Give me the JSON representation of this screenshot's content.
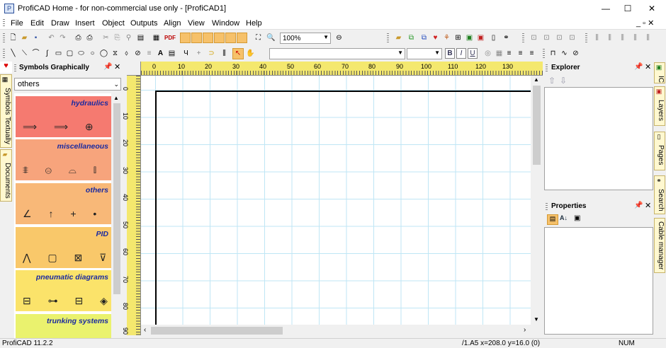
{
  "window": {
    "title": "ProfiCAD Home - for non-commercial use only - [ProfiCAD1]",
    "minimize": "—",
    "maximize": "☐",
    "close": "✕"
  },
  "menu": [
    "File",
    "Edit",
    "Draw",
    "Insert",
    "Object",
    "Outputs",
    "Align",
    "View",
    "Window",
    "Help"
  ],
  "mdi_controls": "_ ▫ ✕",
  "toolbar": {
    "zoom_value": "100%"
  },
  "left_tabs": [
    "Symbols Textually",
    "Documents"
  ],
  "symbols_panel": {
    "title": "Symbols Graphically",
    "category_select": "others",
    "categories": [
      {
        "label": "hydraulics",
        "color": "#f57a70",
        "symbols": "⟹ ⟹ ⊕"
      },
      {
        "label": "miscellaneous",
        "color": "#f7a47c",
        "symbols": "⩨ ⊜ ⌓ ⫾"
      },
      {
        "label": "others",
        "color": "#f8b878",
        "symbols": "∠ ↑ + •"
      },
      {
        "label": "PID",
        "color": "#f9c86a",
        "symbols": "⋀ ▢ ⊠ ⊽"
      },
      {
        "label": "pneumatic diagrams",
        "color": "#fbe36a",
        "symbols": "⊟ ⊶ ⊟ ◈"
      },
      {
        "label": "trunking systems",
        "color": "#eaf26e",
        "symbols": ""
      }
    ]
  },
  "ruler": {
    "h_ticks": [
      "0",
      "10",
      "20",
      "30",
      "40",
      "50",
      "60",
      "70",
      "80",
      "90",
      "100",
      "110",
      "120",
      "130"
    ],
    "v_ticks": [
      "0",
      "10",
      "20",
      "30",
      "40",
      "50",
      "60",
      "70",
      "80",
      "90"
    ]
  },
  "explorer": {
    "title": "Explorer"
  },
  "properties": {
    "title": "Properties"
  },
  "right_tabs": [
    "IC",
    "Layers",
    "Pages",
    "Search",
    "Cable manager"
  ],
  "status": {
    "app": "ProfiCAD 11.2.2",
    "coords": "/1.A5  x=208.0  y=16.0 (0)",
    "num": "NUM"
  }
}
